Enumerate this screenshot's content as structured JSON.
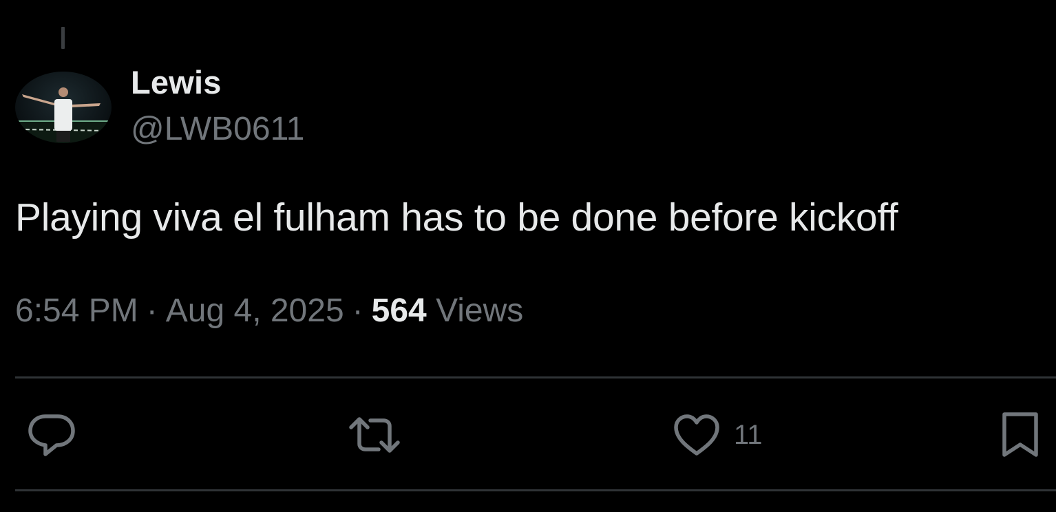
{
  "tweet": {
    "display_name": "Lewis",
    "handle": "@LWB0611",
    "text": "Playing viva el fulham has to be done before kickoff",
    "time": "6:54 PM",
    "separator": "·",
    "date": "Aug 4, 2025",
    "views_count": "564",
    "views_label": "Views"
  },
  "actions": {
    "reply_icon": "reply-icon",
    "repost_icon": "repost-icon",
    "like_icon": "heart-icon",
    "like_count": "11",
    "bookmark_icon": "bookmark-icon"
  },
  "colors": {
    "background": "#000000",
    "primary_text": "#e7e9ea",
    "secondary_text": "#71767b",
    "divider": "#2f3336"
  }
}
